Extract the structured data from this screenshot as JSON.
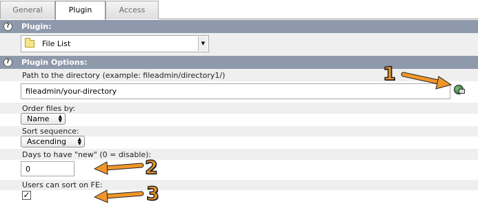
{
  "tabs": [
    {
      "label": "General",
      "active": false
    },
    {
      "label": "Plugin",
      "active": true
    },
    {
      "label": "Access",
      "active": false
    }
  ],
  "plugin_section": {
    "header": "Plugin:",
    "selected_plugin": "File List"
  },
  "options_section": {
    "header": "Plugin Options:",
    "path_label": "Path to the directory (example: fileadmin/directory1/)",
    "path_value": "fileadmin/your-directory",
    "order_label": "Order files by:",
    "order_value": "Name",
    "sort_label": "Sort sequence:",
    "sort_value": "Ascending",
    "days_label": "Days to have \"new\" (0 = disable):",
    "days_value": "0",
    "users_sort_label": "Users can sort on FE:",
    "users_sort_checked": true
  },
  "help_glyph": "?",
  "annotations": [
    "1",
    "2",
    "3"
  ],
  "colors": {
    "section_header": "#8e99ac",
    "row_grey": "#efefef",
    "annotation_orange": "#f0962a"
  },
  "icons": [
    "help-icon",
    "folder-icon",
    "globe-link-icon",
    "dropdown-arrow-icon",
    "stepper-icon",
    "checkmark-icon",
    "annotation-arrow"
  ]
}
